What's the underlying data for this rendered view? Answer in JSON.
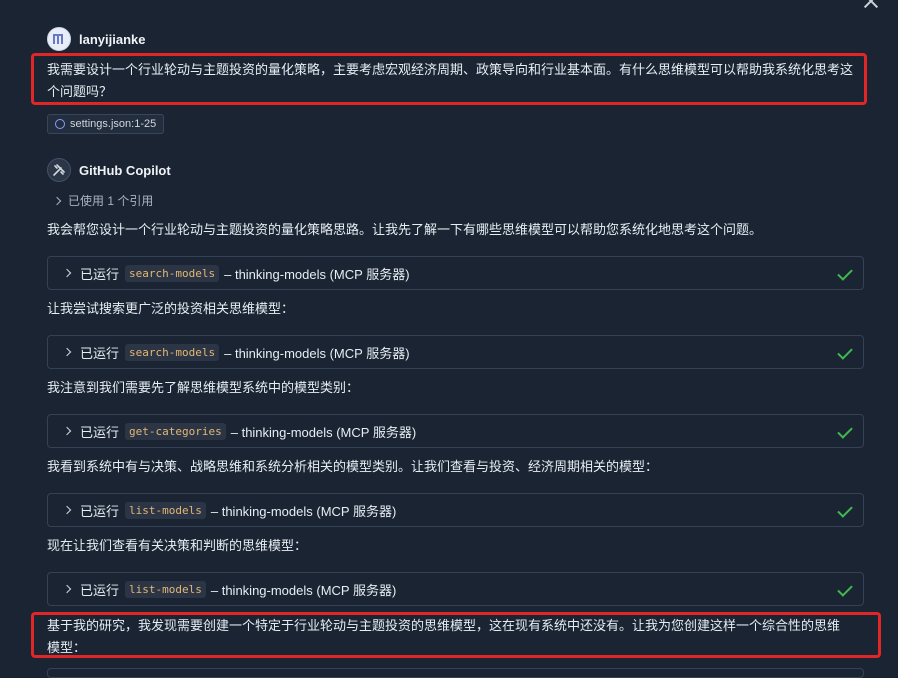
{
  "user": {
    "name": "lanyijianke",
    "message": "我需要设计一个行业轮动与主题投资的量化策略，主要考虑宏观经济周期、政策导向和行业基本面。有什么思维模型可以帮助我系统化思考这个问题吗？",
    "attachment": "settings.json:1-25"
  },
  "assistant": {
    "name": "GitHub Copilot",
    "used_refs": "已使用 1 个引用",
    "intro": "我会帮您设计一个行业轮动与主题投资的量化策略思路。让我先了解一下有哪些思维模型可以帮助您系统化地思考这个问题。",
    "tool_calls": [
      {
        "ran": "已运行",
        "tool": "search-models",
        "suffix": "– thinking-models (MCP 服务器)"
      },
      {
        "ran": "已运行",
        "tool": "search-models",
        "suffix": "– thinking-models (MCP 服务器)"
      },
      {
        "ran": "已运行",
        "tool": "get-categories",
        "suffix": "– thinking-models (MCP 服务器)"
      },
      {
        "ran": "已运行",
        "tool": "list-models",
        "suffix": "– thinking-models (MCP 服务器)"
      },
      {
        "ran": "已运行",
        "tool": "list-models",
        "suffix": "– thinking-models (MCP 服务器)"
      }
    ],
    "texts": [
      "让我尝试搜索更广泛的投资相关思维模型：",
      "我注意到我们需要先了解思维模型系统中的模型类别：",
      "我看到系统中有与决策、战略思维和系统分析相关的模型类别。让我们查看与投资、经济周期相关的模型：",
      "现在让我们查看有关决策和判断的思维模型：",
      "基于我的研究，我发现需要创建一个特定于行业轮动与主题投资的思维模型，这在现有系统中还没有。让我为您创建这样一个综合性的思维模型："
    ]
  },
  "colors": {
    "background": "#1b2433",
    "highlight": "#e02626",
    "success": "#3fb950"
  }
}
